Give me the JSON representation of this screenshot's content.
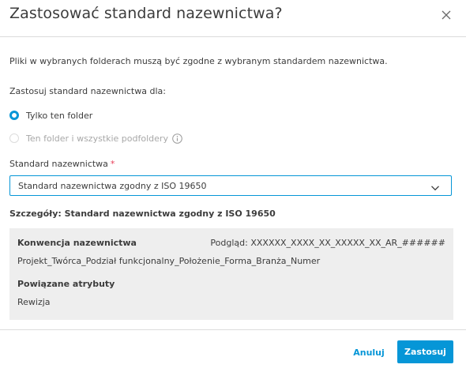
{
  "dialog": {
    "title": "Zastosować standard nazewnictwa?",
    "description": "Pliki w wybranych folderach muszą być zgodne z wybranym standardem nazewnictwa.",
    "apply_for_label": "Zastosuj standard nazewnictwa dla:",
    "options": [
      {
        "label": "Tylko ten folder",
        "selected": true,
        "disabled": false
      },
      {
        "label": "Ten folder i wszystkie podfoldery",
        "selected": false,
        "disabled": true
      }
    ],
    "standard_label": "Standard nazewnictwa",
    "required_marker": "*",
    "selected_standard": "Standard nazewnictwa zgodny z ISO 19650",
    "details_title": "Szczegóły: Standard nazewnictwa zgodny z ISO 19650",
    "details": {
      "convention_title": "Konwencja nazewnictwa",
      "preview": "Podgląd: XXXXXX_XXXX_XX_XXXXX_XX_AR_######",
      "pattern": "Projekt_Twórca_Podział funkcjonalny_Położenie_Forma_Branża_Numer",
      "attributes_title": "Powiązane atrybuty",
      "attributes": [
        "Rewizja"
      ]
    },
    "buttons": {
      "cancel": "Anuluj",
      "apply": "Zastosuj"
    }
  },
  "icons": {
    "close": "close-icon",
    "info": "info-icon",
    "chevron": "chevron-down-icon"
  },
  "colors": {
    "accent": "#0696d7",
    "required": "#e8405a",
    "panel_bg": "#eeeeee",
    "text": "#3c3c3c",
    "disabled_text": "#a8a8a8"
  }
}
